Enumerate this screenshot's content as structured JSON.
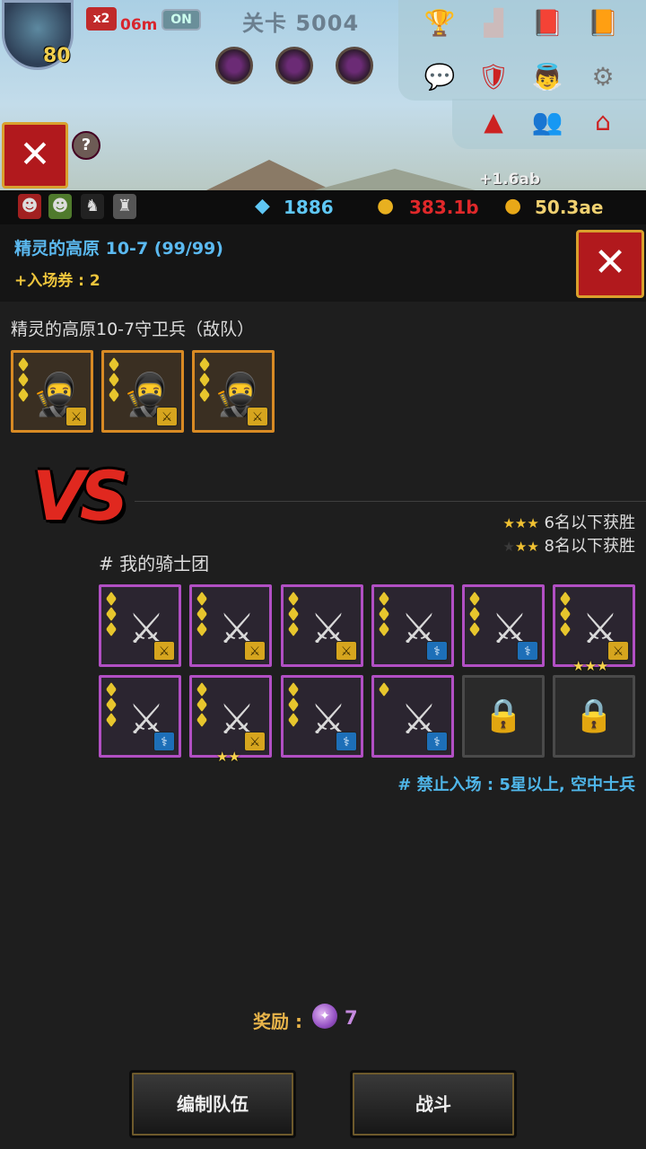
{
  "hud": {
    "player_level": "80",
    "speed_label": "x2",
    "timer": "06m",
    "toggle_label": "ON",
    "stage_label": "关卡 5004",
    "income": "+1.6ab",
    "help_label": "?"
  },
  "resources": {
    "gems": "1886",
    "medals": "383.1b",
    "gold": "50.3ae"
  },
  "header": {
    "region_title": "精灵的高原 10-7 (99/99)",
    "ticket": "+入场券 : 2"
  },
  "enemy": {
    "title": "精灵的高原10-7守卫兵（敌队）",
    "cards": [
      {
        "pips": 3,
        "badge": "sword"
      },
      {
        "pips": 3,
        "badge": "sword"
      },
      {
        "pips": 3,
        "badge": "sword"
      }
    ]
  },
  "vs_label": "VS",
  "conditions": [
    {
      "stars": "★★★",
      "dim": "",
      "text": "6名以下获胜"
    },
    {
      "stars": "★★",
      "dim": "★",
      "text": "8名以下获胜"
    }
  ],
  "ally": {
    "title": "# 我的骑士团",
    "cards": [
      {
        "pips": 3,
        "badge": "sword",
        "stars": ""
      },
      {
        "pips": 3,
        "badge": "sword",
        "stars": ""
      },
      {
        "pips": 3,
        "badge": "sword",
        "stars": ""
      },
      {
        "pips": 3,
        "badge": "staff",
        "stars": ""
      },
      {
        "pips": 3,
        "badge": "staff",
        "stars": ""
      },
      {
        "pips": 3,
        "badge": "sword",
        "stars": "★★★"
      },
      {
        "pips": 3,
        "badge": "staff",
        "stars": ""
      },
      {
        "pips": 3,
        "badge": "sword",
        "stars": "★★"
      },
      {
        "pips": 3,
        "badge": "staff",
        "stars": ""
      },
      {
        "pips": 1,
        "badge": "staff",
        "stars": ""
      }
    ],
    "locked_slots": 2
  },
  "restriction": "# 禁止入场 : 5星以上, 空中士兵",
  "reward": {
    "label": "奖励 :",
    "value": "7"
  },
  "buttons": {
    "edit_team": "编制队伍",
    "battle": "战斗"
  },
  "colors": {
    "accent_blue": "#5bb9f0",
    "accent_gold": "#eec53c",
    "enemy_border": "#d88a24",
    "ally_border": "#b14fc3",
    "close_red": "#b1191d"
  }
}
